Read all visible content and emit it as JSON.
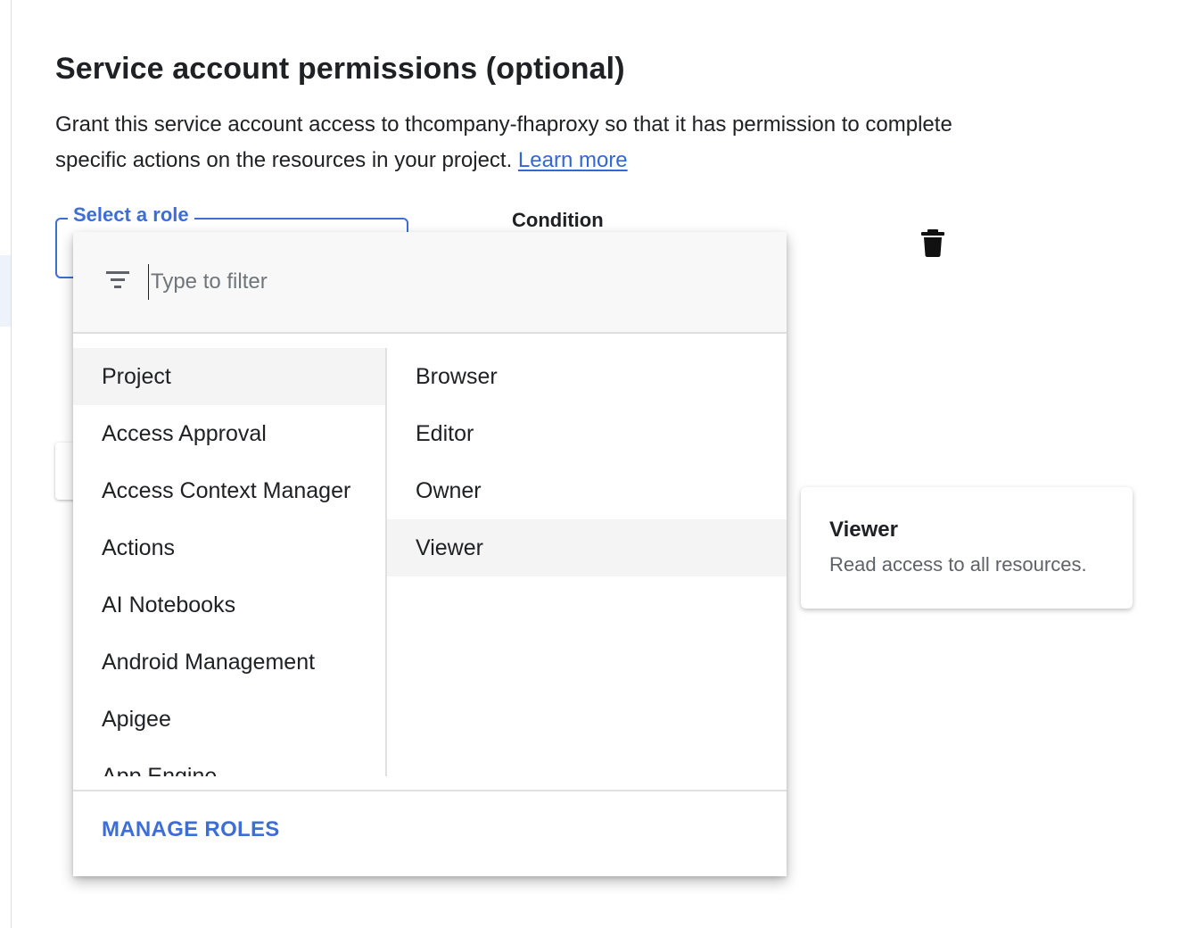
{
  "section": {
    "title": "Service account permissions (optional)",
    "description": "Grant this service account access to thcompany-fhaproxy so that it has permission to complete specific actions on the resources in your project.",
    "learn_more": "Learn more"
  },
  "role_field": {
    "label": "Select a role"
  },
  "condition": {
    "label": "Condition"
  },
  "dropdown": {
    "filter_placeholder": "Type to filter",
    "categories": [
      "Project",
      "Access Approval",
      "Access Context Manager",
      "Actions",
      "AI Notebooks",
      "Android Management",
      "Apigee",
      "App Engine"
    ],
    "selected_category": "Project",
    "roles": [
      "Browser",
      "Editor",
      "Owner",
      "Viewer"
    ],
    "highlighted_role": "Viewer",
    "manage_roles": "MANAGE ROLES"
  },
  "tooltip": {
    "title": "Viewer",
    "body": "Read access to all resources."
  },
  "icons": {
    "filter": "filter-list-icon",
    "delete": "trash-icon"
  },
  "colors": {
    "accent": "#3c6ed6",
    "link": "#3367d6",
    "selected_row": "#f4f4f4"
  }
}
